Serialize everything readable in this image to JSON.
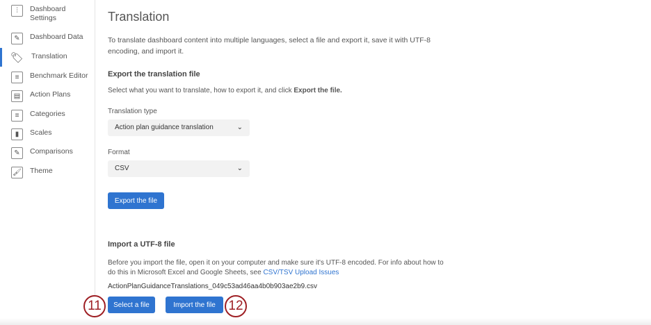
{
  "sidebar": {
    "items": [
      {
        "label": "Dashboard Settings",
        "icon": "sliders-icon"
      },
      {
        "label": "Dashboard Data",
        "icon": "pencil-icon"
      },
      {
        "label": "Translation",
        "icon": "tag-icon"
      },
      {
        "label": "Benchmark Editor",
        "icon": "list-icon"
      },
      {
        "label": "Action Plans",
        "icon": "clipboard-icon"
      },
      {
        "label": "Categories",
        "icon": "list-icon"
      },
      {
        "label": "Scales",
        "icon": "bar-chart-icon"
      },
      {
        "label": "Comparisons",
        "icon": "pencil-icon"
      },
      {
        "label": "Theme",
        "icon": "brush-icon"
      }
    ]
  },
  "main": {
    "title": "Translation",
    "intro_line1": "To translate dashboard content into multiple languages, select a file and export it, save it with UTF-8",
    "intro_line2": "encoding, and import it.",
    "export_heading": "Export the translation file",
    "export_desc": "Select what you want to translate, how to export it, and click ",
    "export_desc_bold": "Export the file.",
    "type_label": "Translation type",
    "type_value": "Action plan guidance translation",
    "format_label": "Format",
    "format_value": "CSV",
    "export_button": "Export the file",
    "import_heading": "Import a UTF-8 file",
    "import_line1": "Before you import the file, open it on your computer and make sure it's UTF-8 encoded. For info about how to",
    "import_line2": "do this in Microsoft Excel and Google Sheets, see ",
    "import_link": "CSV/TSV Upload Issues",
    "filename": "ActionPlanGuidanceTranslations_049c53ad46aa4b0b903ae2b9.csv",
    "select_button": "Select a file",
    "import_button": "Import the file",
    "callout_11": "11",
    "callout_12": "12"
  }
}
